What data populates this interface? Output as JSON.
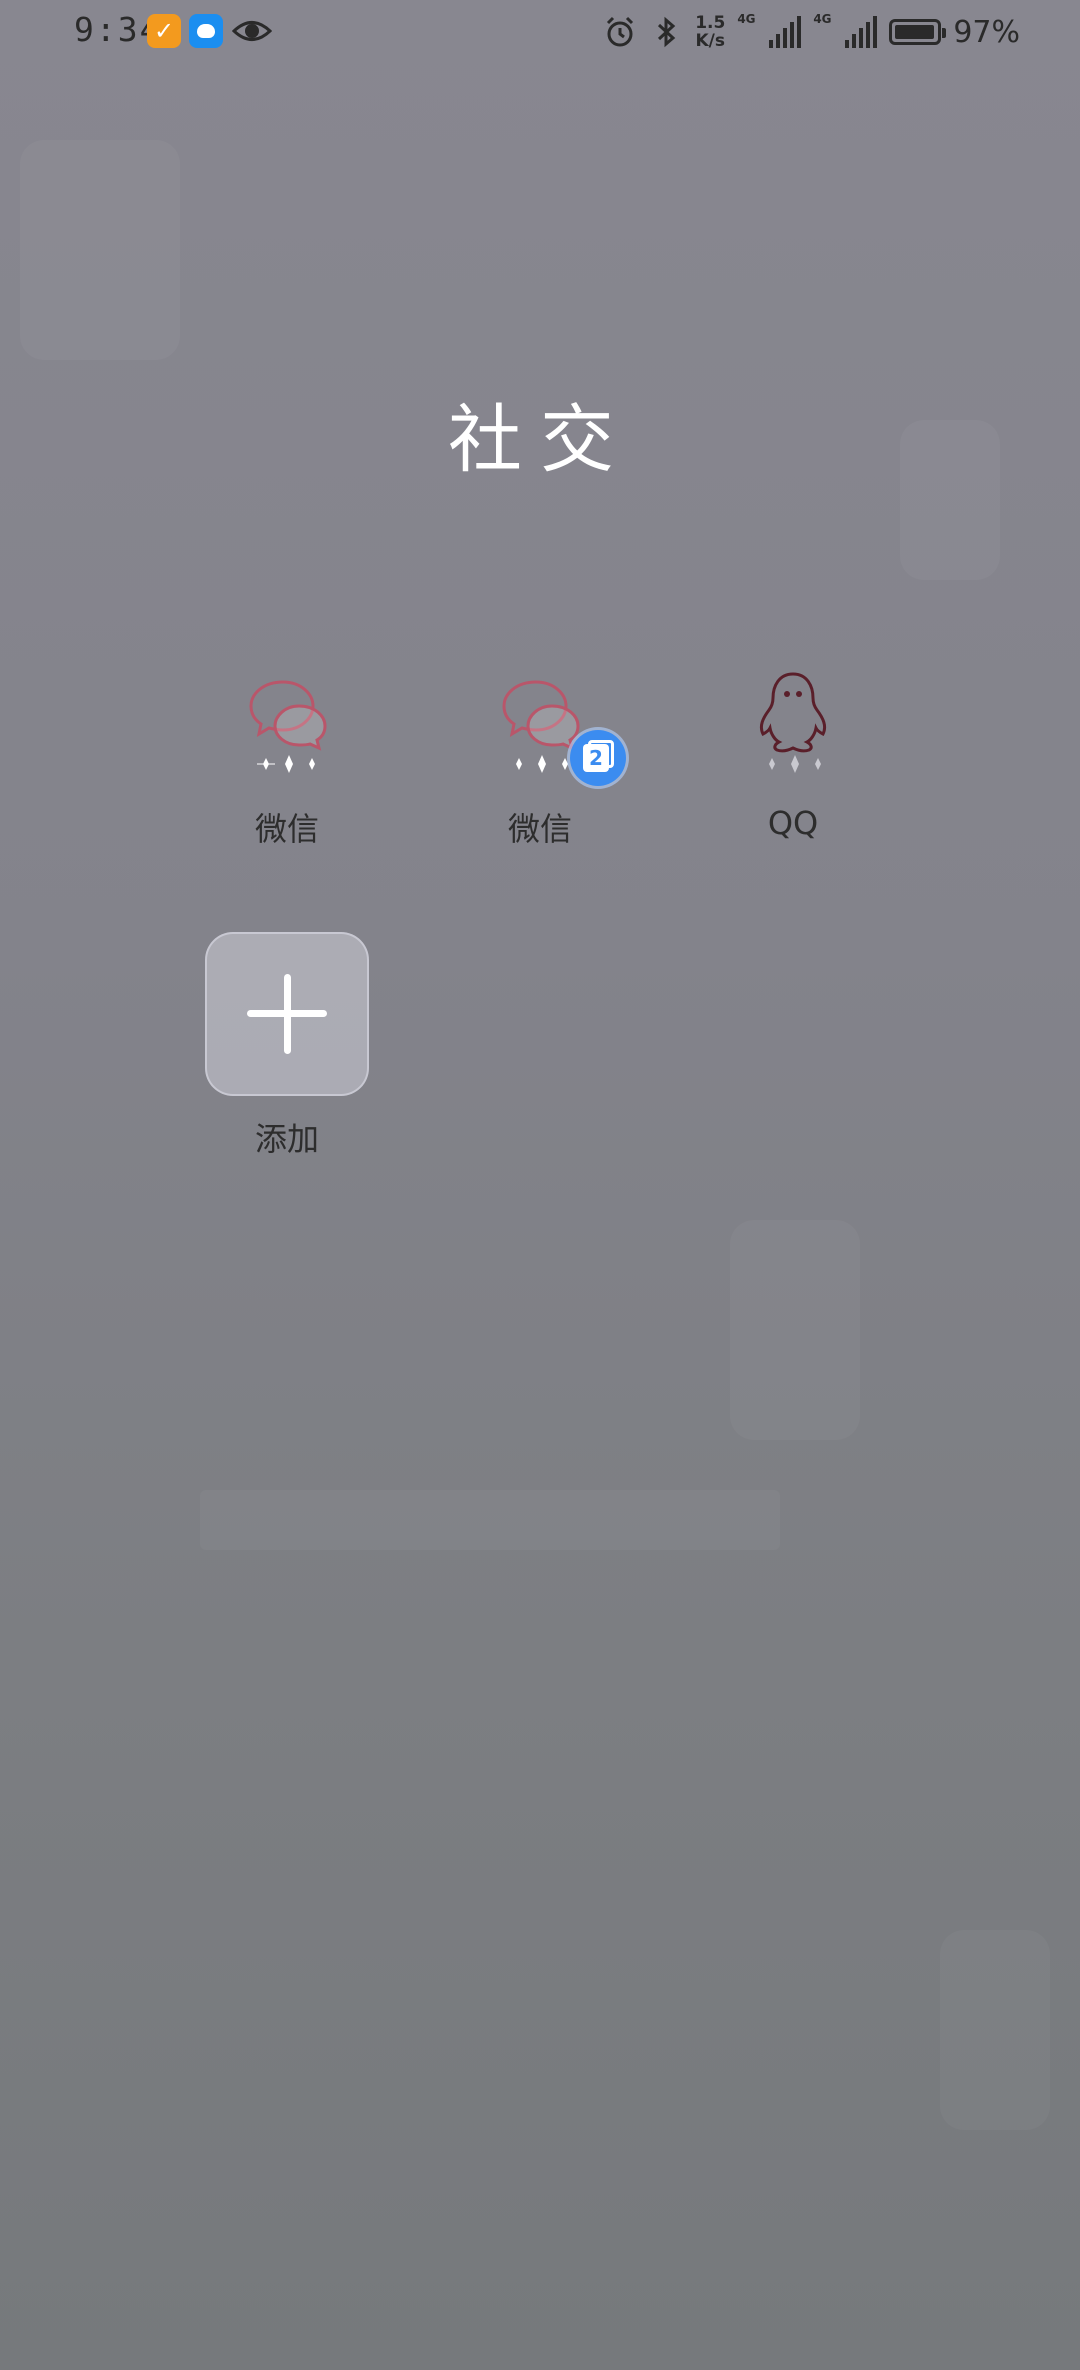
{
  "status_bar": {
    "time": "9:34",
    "net_speed_value": "1.5",
    "net_speed_unit": "K/s",
    "sim1_tag": "4G",
    "sim2_tag": "4G",
    "battery_percent": "97%",
    "battery_level": 0.97,
    "icons": [
      "task-app-icon",
      "weather-app-icon",
      "eye-icon",
      "alarm-icon",
      "bluetooth-icon",
      "signal-icon",
      "battery-icon"
    ]
  },
  "folder": {
    "title": "社交",
    "apps": [
      {
        "label": "微信",
        "icon": "wechat-icon"
      },
      {
        "label": "微信",
        "icon": "wechat-icon",
        "badge": "2"
      },
      {
        "label": "QQ",
        "icon": "qq-penguin-icon"
      }
    ],
    "add_label": "添加"
  },
  "colors": {
    "wechat_outline": "#b9566a",
    "qq_outline": "#5a1f2a",
    "badge_blue": "#3b8cf0",
    "title_white": "#ffffff"
  }
}
